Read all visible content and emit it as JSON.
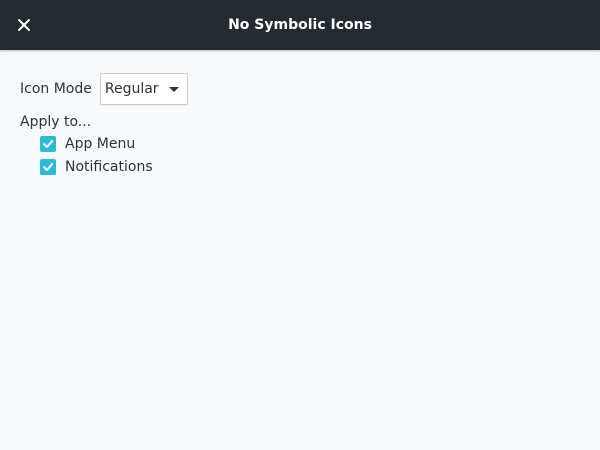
{
  "window": {
    "title": "No Symbolic Icons"
  },
  "icon_mode": {
    "label": "Icon Mode",
    "selected": "Regular"
  },
  "apply_to": {
    "label": "Apply to...",
    "options": [
      {
        "label": "App Menu",
        "checked": true
      },
      {
        "label": "Notifications",
        "checked": true
      }
    ]
  },
  "colors": {
    "headerbar": "#232b30",
    "accent": "#2cbbd6",
    "background": "#f8f9fb",
    "text": "#2e3436"
  },
  "icons": {
    "close": "close-icon",
    "dropdown": "chevron-down-icon",
    "check": "check-icon"
  }
}
